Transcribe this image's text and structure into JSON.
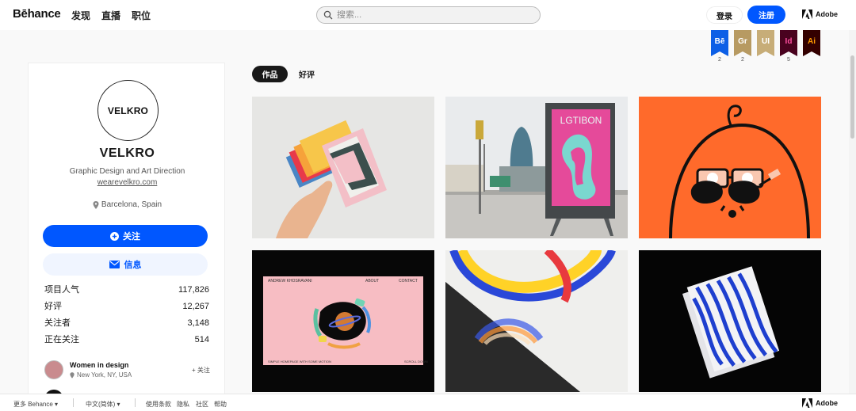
{
  "header": {
    "logo": "Bēhance",
    "nav": [
      "发现",
      "直播",
      "职位"
    ],
    "search_placeholder": "搜索...",
    "login": "登录",
    "signup": "注册",
    "adobe": "Adobe"
  },
  "badges": [
    {
      "label": "Bē",
      "count": "2",
      "color": "#0d5fe6"
    },
    {
      "label": "Gr",
      "count": "2",
      "color": "#b79a62"
    },
    {
      "label": "UI",
      "count": "",
      "color": "#c7ad78"
    },
    {
      "label": "Id",
      "count": "5",
      "color": "#49021f"
    },
    {
      "label": "Ai",
      "count": "",
      "color": "#330000"
    }
  ],
  "profile": {
    "avatar_text": "VELKRO",
    "name": "VELKRO",
    "tagline": "Graphic Design and Art Direction",
    "website": "wearevelkro.com",
    "location": "Barcelona, Spain",
    "follow_label": "关注",
    "message_label": "信息",
    "stats": [
      {
        "label": "项目人气",
        "value": "117,826"
      },
      {
        "label": "好评",
        "value": "12,267"
      },
      {
        "label": "关注者",
        "value": "3,148"
      },
      {
        "label": "正在关注",
        "value": "514"
      }
    ],
    "recommended": {
      "name": "Women in design",
      "location": "New York, NY, USA",
      "follow_label": "+ 关注"
    },
    "recommended2_name": "... ... ..."
  },
  "tabs": {
    "active": "作品",
    "other": "好评"
  },
  "projects": {
    "p2_poster_title": "LGTIBON",
    "p4_left_header": "ANDREW KHOSRAVANI",
    "p4_nav_about": "ABOUT",
    "p4_nav_contact": "CONTACT",
    "p4_footer_left": "SIMPLE HOMEPAGE WITH SOME MOTION",
    "p4_footer_right": "SCROLL DOWN"
  },
  "footer": {
    "more": "更多 Behance",
    "language": "中文(简体)",
    "terms": "使用条款",
    "privacy": "隐私",
    "community": "社区",
    "help": "帮助",
    "adobe": "Adobe"
  },
  "colors": {
    "accent": "#0057ff",
    "tile3_bg": "#ff6a2b"
  }
}
